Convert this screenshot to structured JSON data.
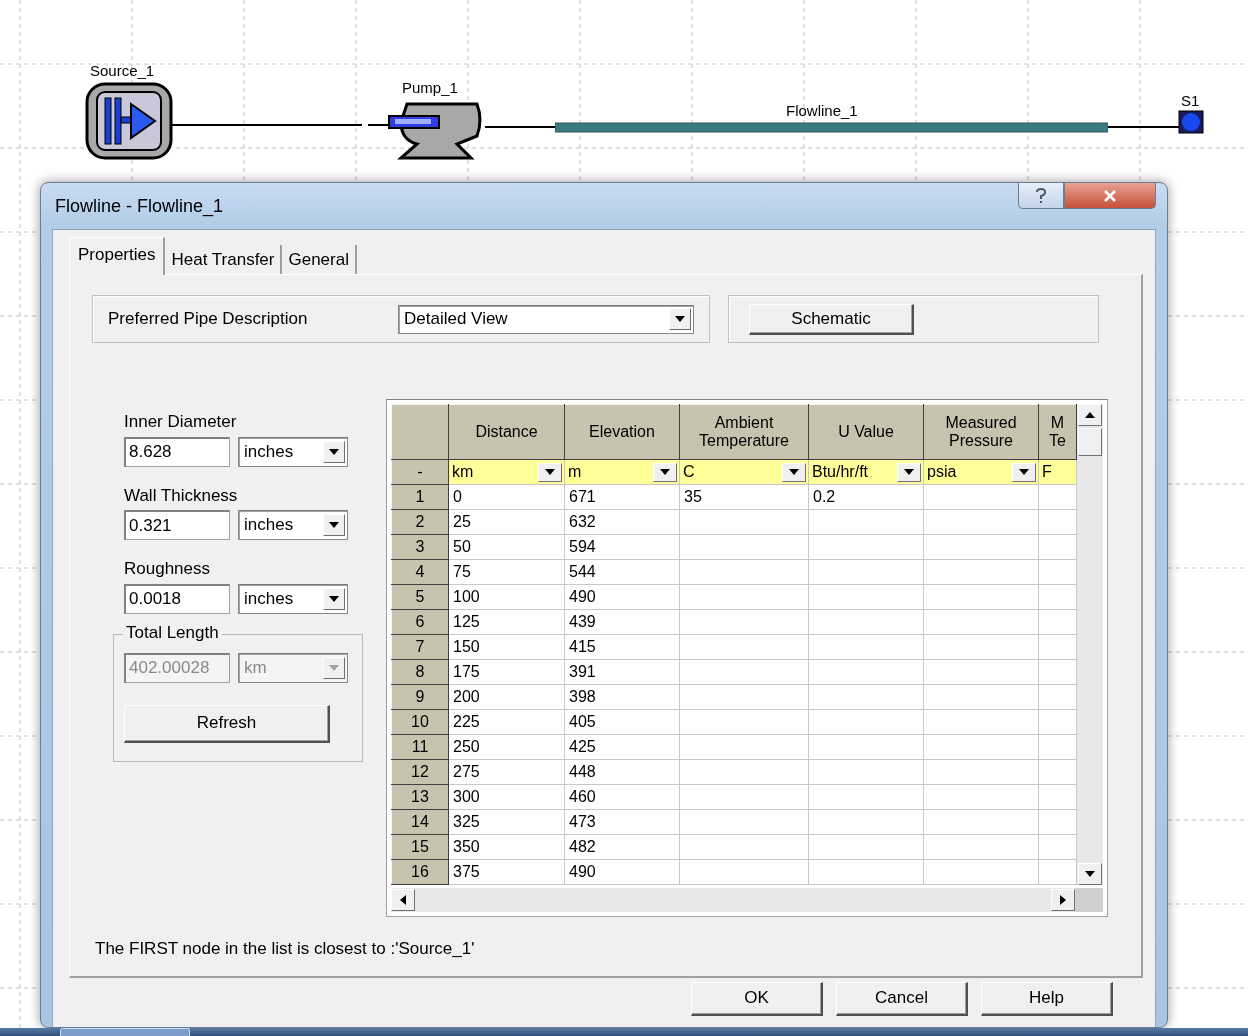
{
  "diagram": {
    "nodes": [
      {
        "kind": "source",
        "label": "Source_1"
      },
      {
        "kind": "pump",
        "label": "Pump_1"
      },
      {
        "kind": "flowline",
        "label": "Flowline_1"
      },
      {
        "kind": "sink",
        "label": "S1"
      }
    ]
  },
  "dialog": {
    "title": "Flowline - Flowline_1",
    "tabs": [
      {
        "label": "Properties",
        "selected": true
      },
      {
        "label": "Heat Transfer",
        "selected": false
      },
      {
        "label": "General",
        "selected": false
      }
    ],
    "pipe_description": {
      "label": "Preferred Pipe Description",
      "value": "Detailed View"
    },
    "schematic_button": "Schematic",
    "fields": [
      {
        "label": "Inner Diameter",
        "value": "8.628",
        "unit": "inches"
      },
      {
        "label": "Wall Thickness",
        "value": "0.321",
        "unit": "inches"
      },
      {
        "label": "Roughness",
        "value": "0.0018",
        "unit": "inches"
      }
    ],
    "total_length": {
      "legend": "Total Length",
      "value": "402.00028",
      "unit": "km",
      "disabled": true
    },
    "refresh_button": "Refresh",
    "grid": {
      "columns": [
        "Distance",
        "Elevation",
        "Ambient Temperature",
        "U Value",
        "Measured Pressure",
        "M Te"
      ],
      "unit_row_label": "-",
      "units": [
        "km",
        "m",
        "C",
        "Btu/hr/ft",
        "psia",
        "F"
      ],
      "rows": [
        {
          "number": "1",
          "cells": [
            "0",
            "671",
            "35",
            "0.2"
          ]
        },
        {
          "number": "2",
          "cells": [
            "25",
            "632"
          ]
        },
        {
          "number": "3",
          "cells": [
            "50",
            "594"
          ]
        },
        {
          "number": "4",
          "cells": [
            "75",
            "544"
          ]
        },
        {
          "number": "5",
          "cells": [
            "100",
            "490"
          ]
        },
        {
          "number": "6",
          "cells": [
            "125",
            "439"
          ]
        },
        {
          "number": "7",
          "cells": [
            "150",
            "415"
          ]
        },
        {
          "number": "8",
          "cells": [
            "175",
            "391"
          ]
        },
        {
          "number": "9",
          "cells": [
            "200",
            "398"
          ]
        },
        {
          "number": "10",
          "cells": [
            "225",
            "405"
          ]
        },
        {
          "number": "11",
          "cells": [
            "250",
            "425"
          ]
        },
        {
          "number": "12",
          "cells": [
            "275",
            "448"
          ]
        },
        {
          "number": "13",
          "cells": [
            "300",
            "460"
          ]
        },
        {
          "number": "14",
          "cells": [
            "325",
            "473"
          ]
        },
        {
          "number": "15",
          "cells": [
            "350",
            "482"
          ]
        },
        {
          "number": "16",
          "cells": [
            "375",
            "490"
          ]
        }
      ]
    },
    "note": "The FIRST node in the list is closest to :'Source_1'",
    "buttons": [
      "OK",
      "Cancel",
      "Help"
    ]
  }
}
